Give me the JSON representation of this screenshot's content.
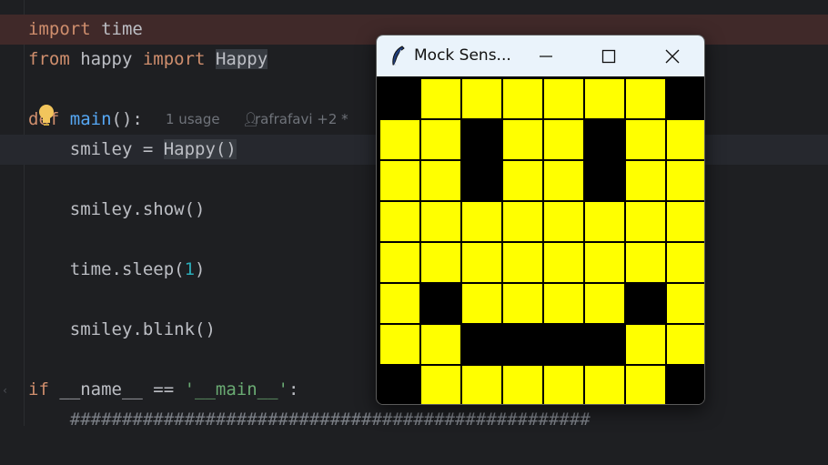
{
  "editor": {
    "line_import_kw": "import",
    "line_import_mod": " time",
    "line_from_kw": "from",
    "line_from_mod": " happy ",
    "line_from_import": "import",
    "line_from_sym": "Happy",
    "def_kw": "def",
    "def_name": "main",
    "def_tail": "():",
    "usage_hint": "1 usage",
    "author_hint": "rafrafavi +2 *",
    "smiley_lhs": "    smiley = ",
    "smiley_call": "Happy",
    "smiley_paren": "()",
    "show_line": "    smiley.show()",
    "sleep_head": "    time.sleep(",
    "sleep_num": "1",
    "sleep_tail": ")",
    "blink_line": "    smiley.blink()",
    "if_kw": "if",
    "if_mid": " __name__ == ",
    "if_str": "'__main__'",
    "if_tail": ":",
    "hash_line": "    ##################################################"
  },
  "window": {
    "title": "Mock Sens...",
    "minimize_icon": "minimize-icon",
    "maximize_icon": "maximize-icon",
    "close_icon": "close-icon"
  },
  "colors": {
    "on": "#ffff00",
    "off": "#000000"
  },
  "led_matrix": [
    [
      0,
      1,
      1,
      1,
      1,
      1,
      1,
      0
    ],
    [
      1,
      1,
      0,
      1,
      1,
      0,
      1,
      1
    ],
    [
      1,
      1,
      0,
      1,
      1,
      0,
      1,
      1
    ],
    [
      1,
      1,
      1,
      1,
      1,
      1,
      1,
      1
    ],
    [
      1,
      1,
      1,
      1,
      1,
      1,
      1,
      1
    ],
    [
      1,
      0,
      1,
      1,
      1,
      1,
      0,
      1
    ],
    [
      1,
      1,
      0,
      0,
      0,
      0,
      1,
      1
    ],
    [
      0,
      1,
      1,
      1,
      1,
      1,
      1,
      0
    ]
  ]
}
